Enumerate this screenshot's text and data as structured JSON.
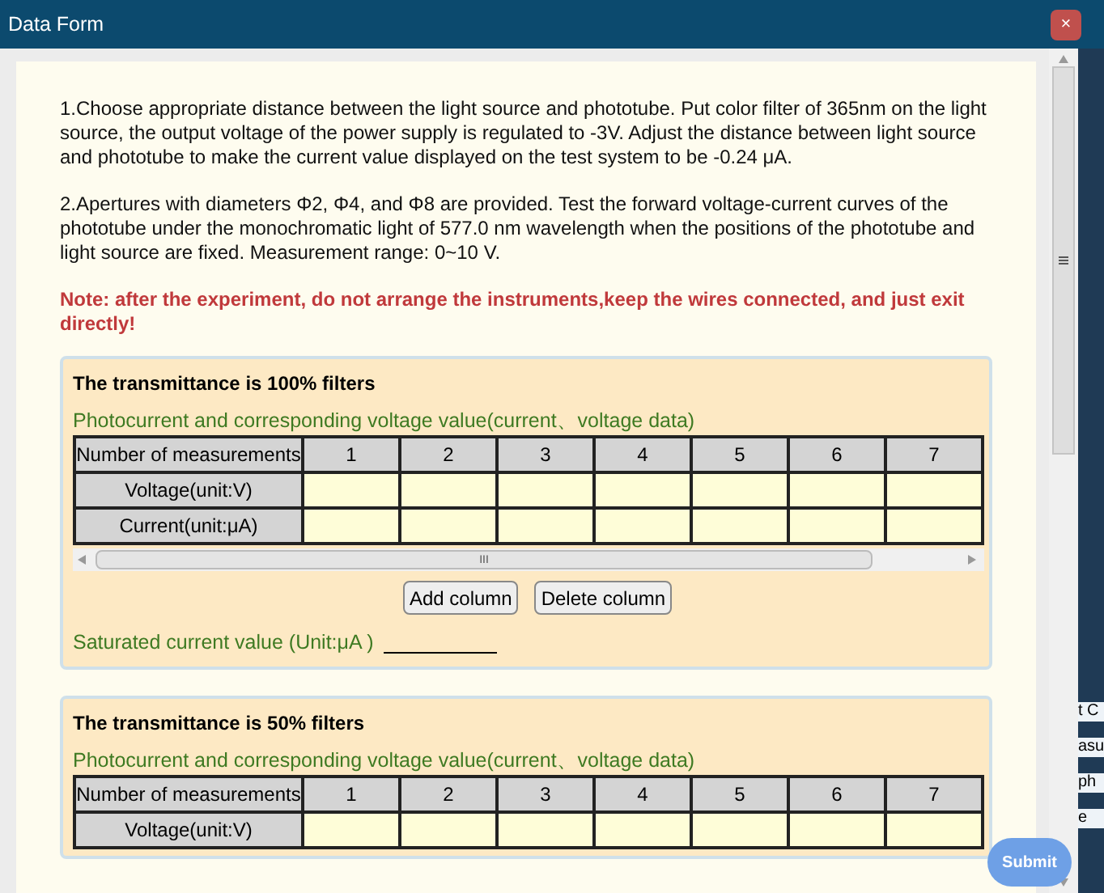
{
  "window": {
    "title": "Data Form",
    "close": "×"
  },
  "instructions": [
    "1.Choose appropriate distance between the light source and phototube. Put color filter of 365nm on the light source, the output voltage of the power supply is regulated to -3V. Adjust the distance between light source and phototube to make the current value displayed on the test system to be -0.24 μA.",
    "2.Apertures with diameters Φ2, Φ4, and Φ8 are provided. Test the forward voltage-current curves of the phototube under the monochromatic light of 577.0 nm wavelength when the positions of the phototube and light source are fixed. Measurement range: 0~10 V."
  ],
  "note": "Note: after the experiment, do not arrange the instruments,keep the wires connected,  and just exit directly!",
  "sections": [
    {
      "title": "The transmittance is 100% filters",
      "subtitle": "Photocurrent and corresponding voltage value(current、voltage data)",
      "columns": [
        "Number of measurements",
        "1",
        "2",
        "3",
        "4",
        "5",
        "6",
        "7"
      ],
      "rows": [
        "Voltage(unit:V)",
        "Current(unit:μA)"
      ],
      "scroll_grip": "III",
      "buttons": [
        "Add column",
        "Delete column"
      ],
      "saturated_label": "Saturated current value (Unit:μA )"
    },
    {
      "title": "The transmittance is 50% filters",
      "subtitle": "Photocurrent and corresponding voltage value(current、voltage data)",
      "columns": [
        "Number of measurements",
        "1",
        "2",
        "3",
        "4",
        "5",
        "6",
        "7"
      ],
      "rows": [
        "Voltage(unit:V)"
      ]
    }
  ],
  "submit": "Submit",
  "background_fragments": [
    "t C",
    "asu",
    "ph",
    "e"
  ]
}
